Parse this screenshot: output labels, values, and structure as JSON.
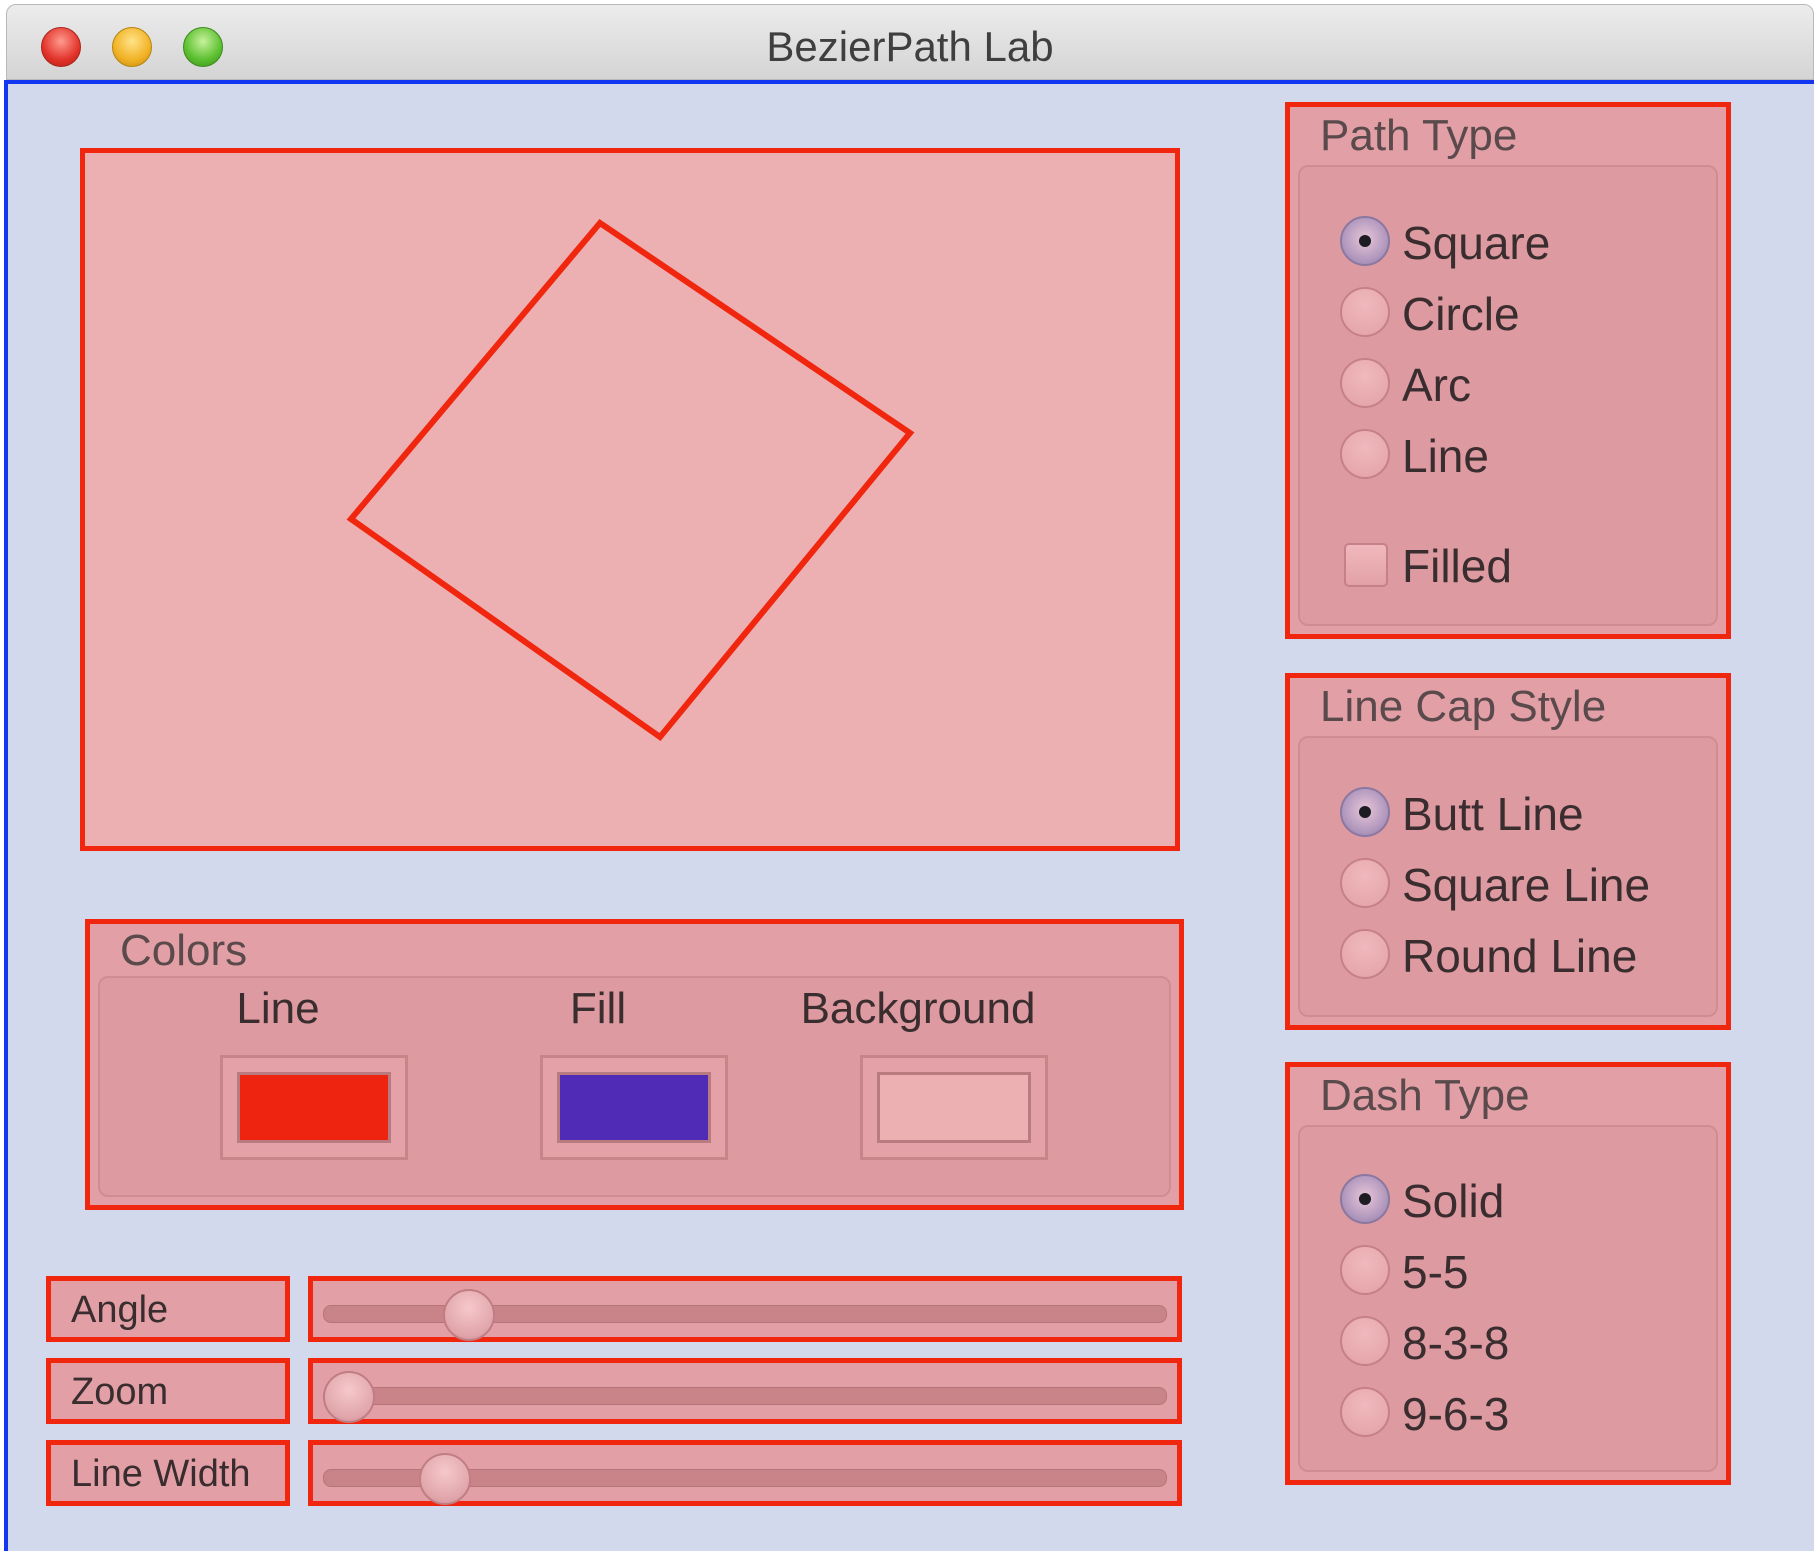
{
  "window": {
    "title": "BezierPath Lab",
    "traffic_lights": [
      "close",
      "minimize",
      "zoom"
    ]
  },
  "canvas": {
    "shape": "square",
    "line_color": "#f0260e",
    "fill_color": "#ecb0b3",
    "background_color": "#ecb0b3",
    "filled": false
  },
  "colors": {
    "title": "Colors",
    "line_label": "Line",
    "fill_label": "Fill",
    "background_label": "Background",
    "line_swatch": "#ef2410",
    "fill_swatch": "#502cb6",
    "background_swatch": "#ecb0b3"
  },
  "sliders": {
    "angle": {
      "label": "Angle",
      "value": 0.15
    },
    "zoom": {
      "label": "Zoom",
      "value": 0.0
    },
    "line_width": {
      "label": "Line Width",
      "value": 0.12
    }
  },
  "path_type": {
    "title": "Path Type",
    "options": [
      "Square",
      "Circle",
      "Arc",
      "Line"
    ],
    "selected": "Square",
    "filled_label": "Filled",
    "filled_checked": false
  },
  "line_cap": {
    "title": "Line Cap Style",
    "options": [
      "Butt Line",
      "Square Line",
      "Round Line"
    ],
    "selected": "Butt Line"
  },
  "dash_type": {
    "title": "Dash Type",
    "options": [
      "Solid",
      "5-5",
      "8-3-8",
      "9-6-3"
    ],
    "selected": "Solid"
  }
}
